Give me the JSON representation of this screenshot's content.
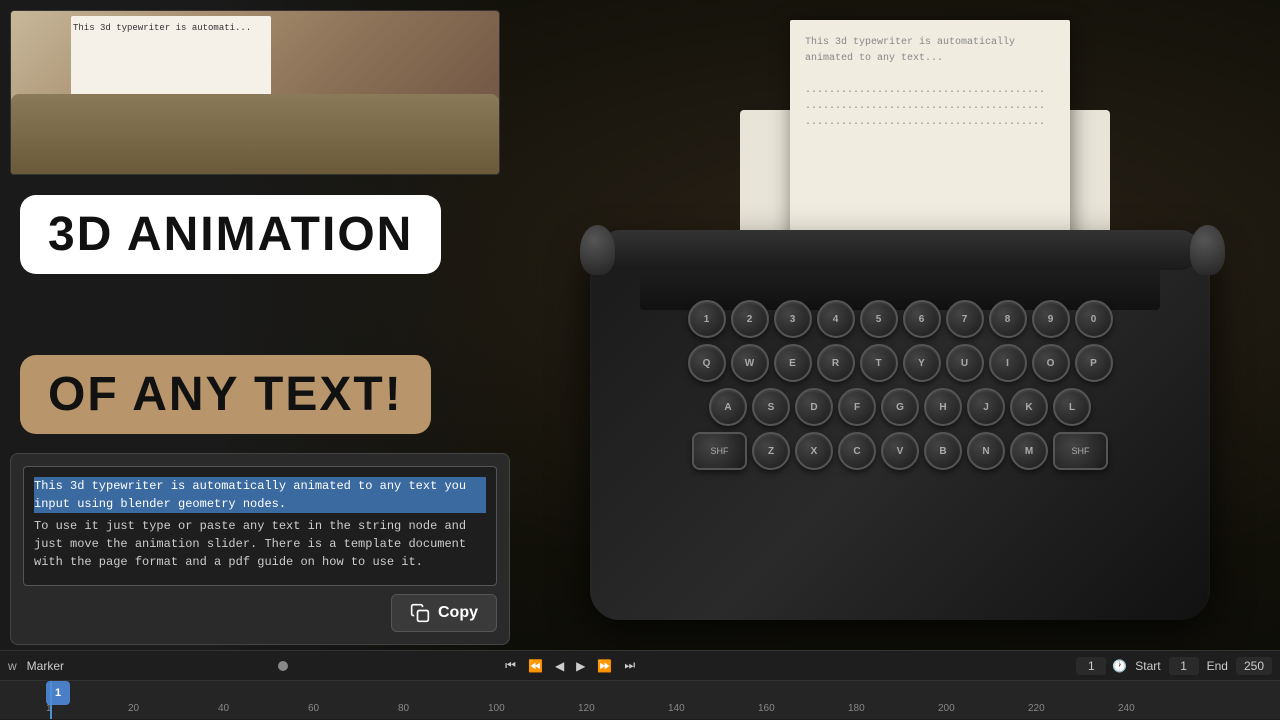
{
  "viewport": {
    "background_color": "#111111"
  },
  "preview": {
    "text": "This 3d typewriter is automati..."
  },
  "title1": "3D ANIMATION",
  "title2": "OF ANY TEXT!",
  "editor": {
    "line1": "This 3d typewriter is automatically animated to any text you input using blender geometry nodes.",
    "line2": "To use it just type or paste any text in the string node and just move the animation slider. There is a template document with the page format and a pdf guide on how to use it.",
    "copy_button_label": "Copy"
  },
  "typewriter_keys": {
    "row1": [
      "1",
      "2",
      "3",
      "4",
      "5",
      "6",
      "7",
      "8",
      "9",
      "0"
    ],
    "row2": [
      "Q",
      "W",
      "E",
      "R",
      "T",
      "Y",
      "U",
      "I",
      "O",
      "P"
    ],
    "row3": [
      "A",
      "S",
      "D",
      "F",
      "G",
      "H",
      "J",
      "K",
      "L"
    ],
    "row4": [
      "Z",
      "X",
      "C",
      "V",
      "B",
      "N",
      "M"
    ]
  },
  "timeline": {
    "marker_label": "Marker",
    "start_label": "Start",
    "end_label": "End",
    "start_value": "1",
    "end_value": "250",
    "current_frame": "1",
    "ruler_marks": [
      "1",
      "20",
      "40",
      "60",
      "80",
      "100",
      "120",
      "140",
      "160",
      "180",
      "200",
      "220",
      "240"
    ],
    "frame_marker": "1"
  }
}
